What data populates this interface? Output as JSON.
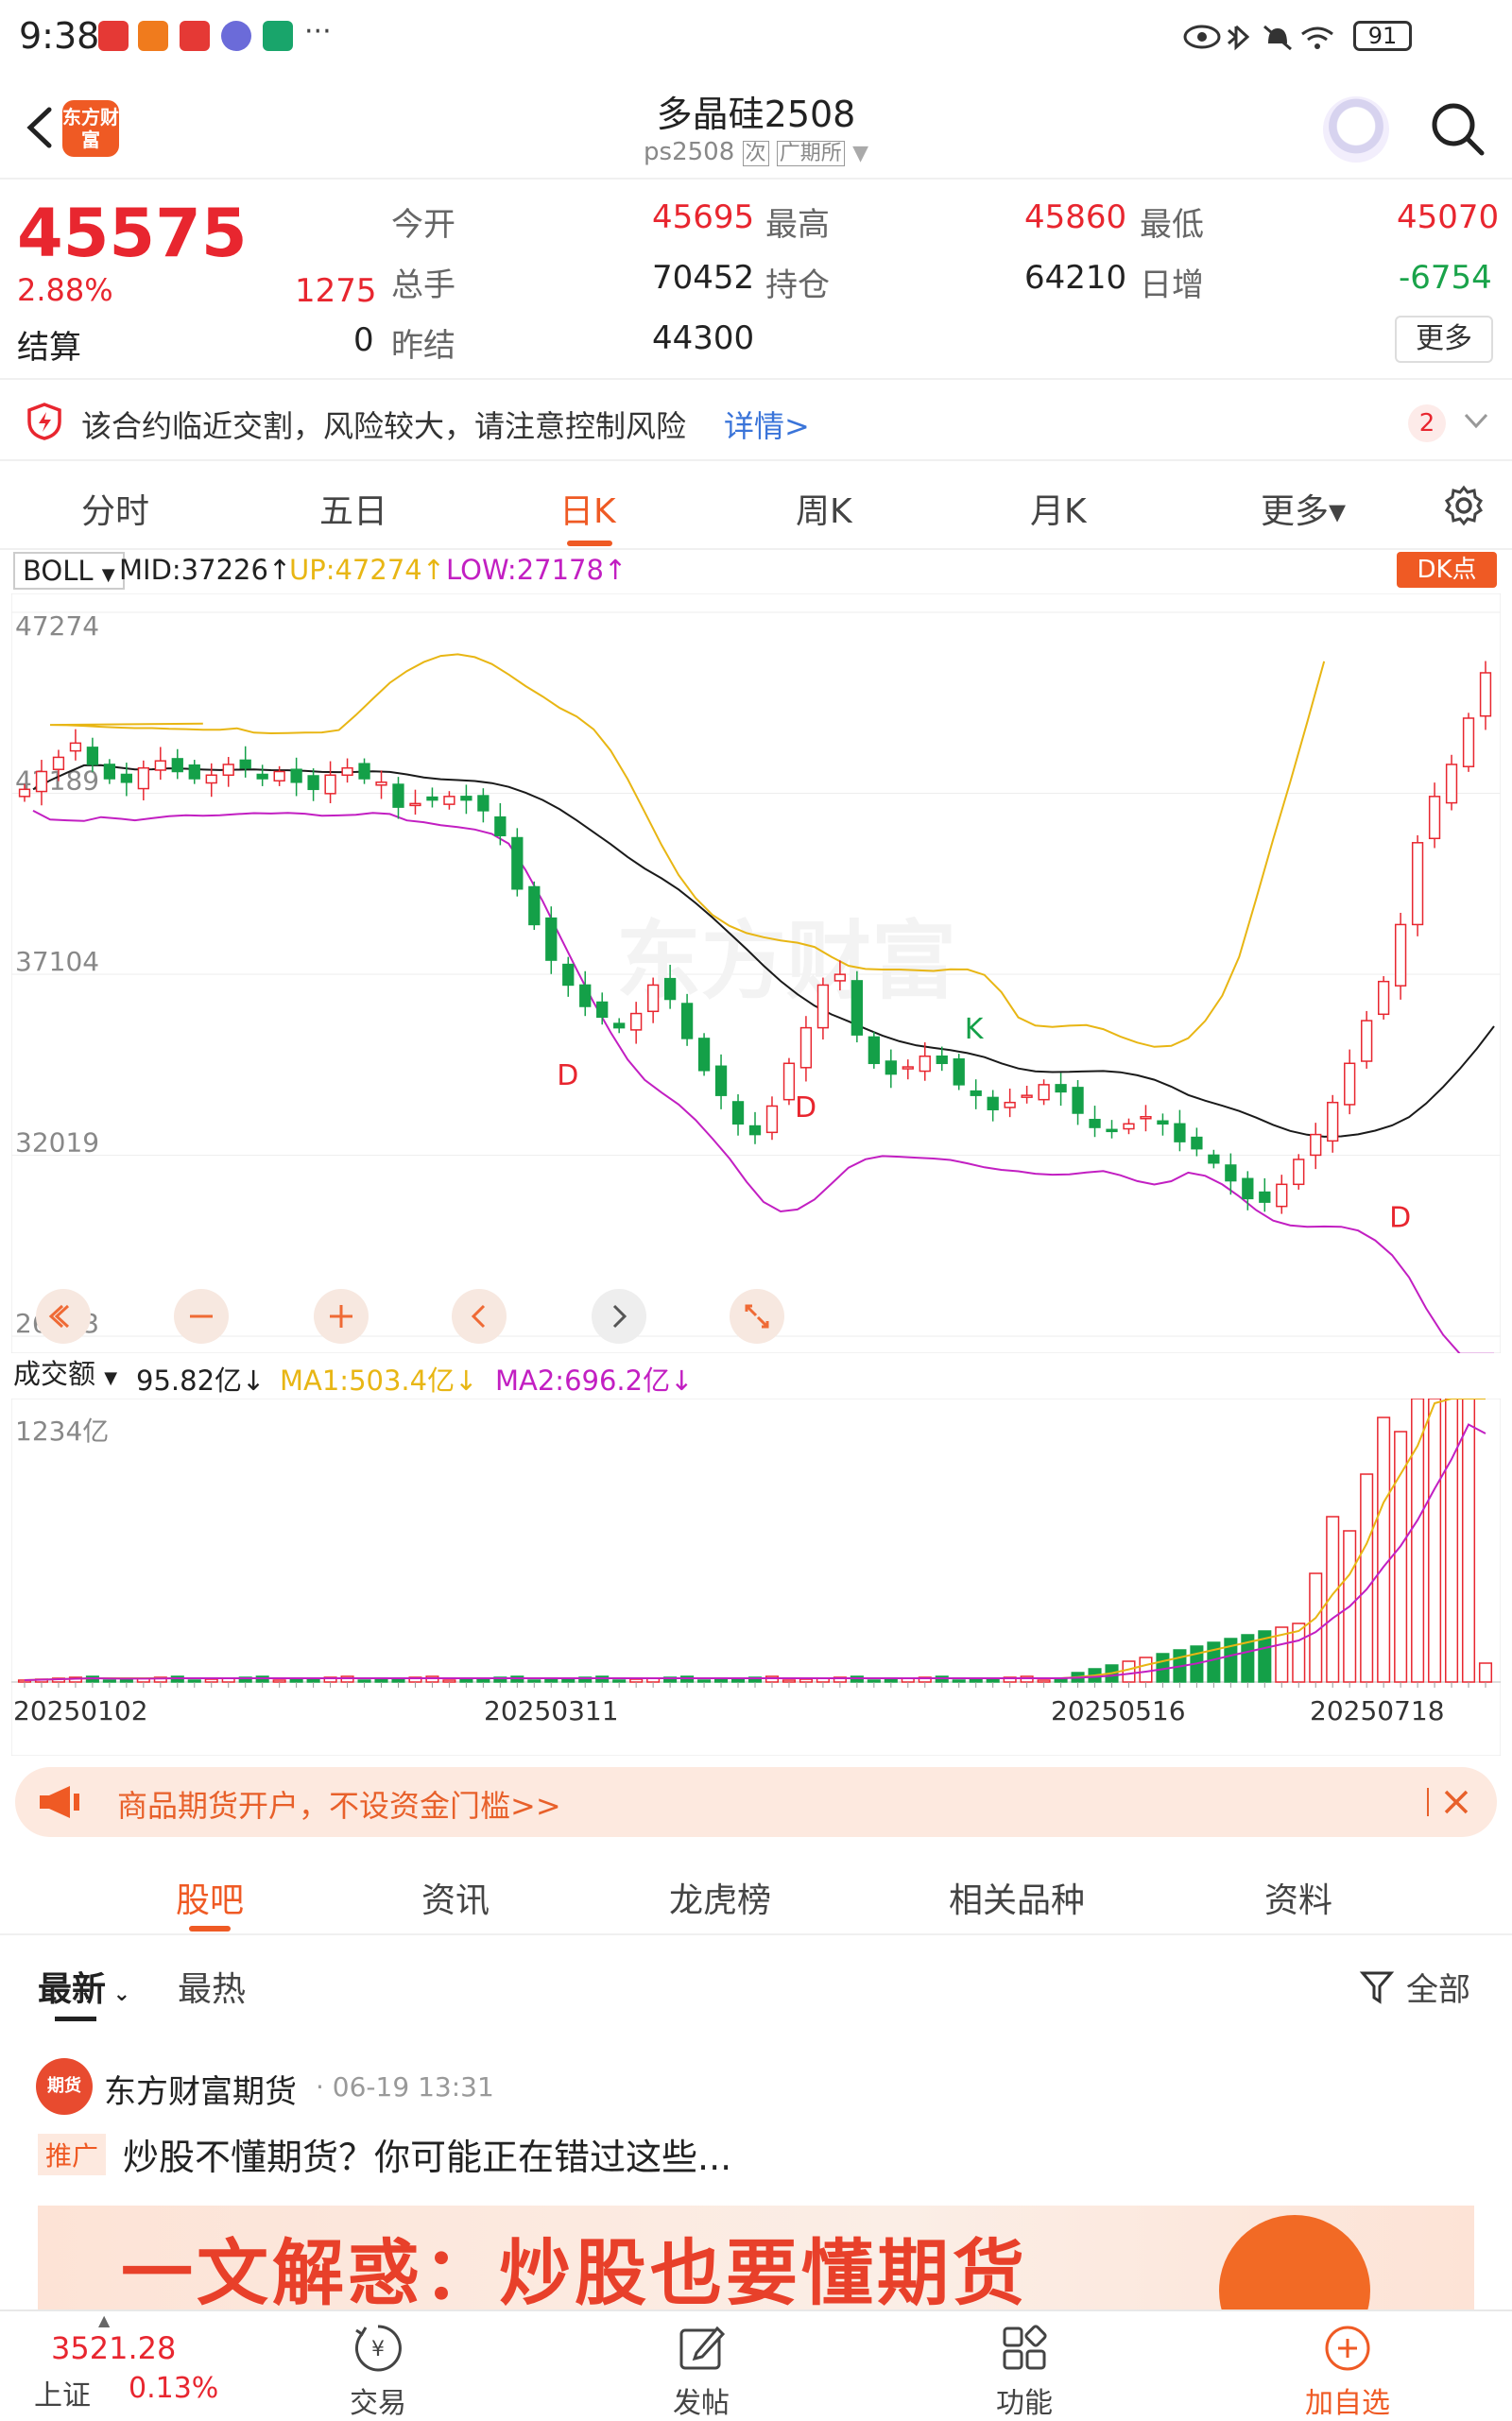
{
  "status_bar": {
    "time": "9:38",
    "battery": "91"
  },
  "header": {
    "logo_text": "东方财富",
    "title": "多晶硅2508",
    "subtitle": "ps2508",
    "tag1": "次",
    "tag2": "广期所"
  },
  "quote": {
    "last": "45575",
    "change_pct": "2.88%",
    "change": "1275",
    "open_label": "今开",
    "open": "45695",
    "high_label": "最高",
    "high": "45860",
    "low_label": "最低",
    "low": "45070",
    "vol_label": "总手",
    "vol": "70452",
    "oi_label": "持仓",
    "oi": "64210",
    "oi_chg_label": "日增",
    "oi_chg": "-6754",
    "settle_label": "结算",
    "settle": "0",
    "prev_label": "昨结",
    "prev": "44300",
    "more_label": "更多"
  },
  "risk": {
    "text": "该合约临近交割，风险较大，请注意控制风险",
    "link": "详情>",
    "badge": "2"
  },
  "period_tabs": [
    "分时",
    "五日",
    "日K",
    "周K",
    "月K",
    "更多▾"
  ],
  "boll": {
    "name": "BOLL",
    "mid": "MID:37226↑",
    "up": "UP:47274↑",
    "low": "LOW:27178↑",
    "dk": "DK点"
  },
  "volume": {
    "name": "成交额",
    "value": "95.82亿↓",
    "ma1": "MA1:503.4亿↓",
    "ma2": "MA2:696.2亿↓",
    "max_label": "1234亿"
  },
  "chart_data": {
    "type": "candlestick",
    "y_ticks": [
      "47274",
      "42189",
      "37104",
      "32019",
      "26933"
    ],
    "x_ticks": [
      "20250102",
      "20250311",
      "20250516",
      "20250718"
    ],
    "markers": [
      "D",
      "D",
      "K",
      "D"
    ],
    "close_series": [
      42300,
      42800,
      43200,
      43600,
      43000,
      42600,
      42500,
      42900,
      43100,
      42800,
      42600,
      42700,
      43000,
      42900,
      42600,
      42800,
      42500,
      42300,
      42700,
      42900,
      42600,
      42500,
      41800,
      41900,
      42000,
      42100,
      42000,
      41700,
      41000,
      39500,
      38500,
      37500,
      36800,
      36200,
      35900,
      35600,
      36000,
      36800,
      36400,
      35300,
      34400,
      33700,
      32900,
      32600,
      33400,
      34600,
      35600,
      36800,
      37100,
      35400,
      34600,
      34300,
      34500,
      34800,
      34600,
      34000,
      33700,
      33300,
      33500,
      33700,
      34000,
      33800,
      33200,
      32800,
      32700,
      32900,
      33100,
      32900,
      32400,
      32200,
      31800,
      31300,
      30800,
      30700,
      31200,
      31900,
      32600,
      33500,
      34600,
      35800,
      36900,
      38500,
      40800,
      42100,
      43000,
      44300,
      45575
    ],
    "colors": {
      "up": "#e8262f",
      "down": "#14a048",
      "mid": "#1a1a1a",
      "upper": "#e8b614",
      "lower": "#c21fc2"
    }
  },
  "banner": {
    "text": "商品期货开户，不设资金门槛>>"
  },
  "content_tabs": [
    "股吧",
    "资讯",
    "龙虎榜",
    "相关品种",
    "资料"
  ],
  "sub_tabs": {
    "latest": "最新",
    "hot": "最热",
    "filter": "全部"
  },
  "post": {
    "avatar": "期货",
    "author": "东方财富期货",
    "time": "· 06-19 13:31",
    "tag": "推广",
    "title": "炒股不懂期货？你可能正在错过这些...",
    "image_text": "一文解惑：炒股也要懂期货"
  },
  "bottom_nav": {
    "index_value": "3521.28",
    "index_name": "上证",
    "index_pct": "0.13%",
    "trade": "交易",
    "post": "发帖",
    "func": "功能",
    "watch": "加自选"
  }
}
